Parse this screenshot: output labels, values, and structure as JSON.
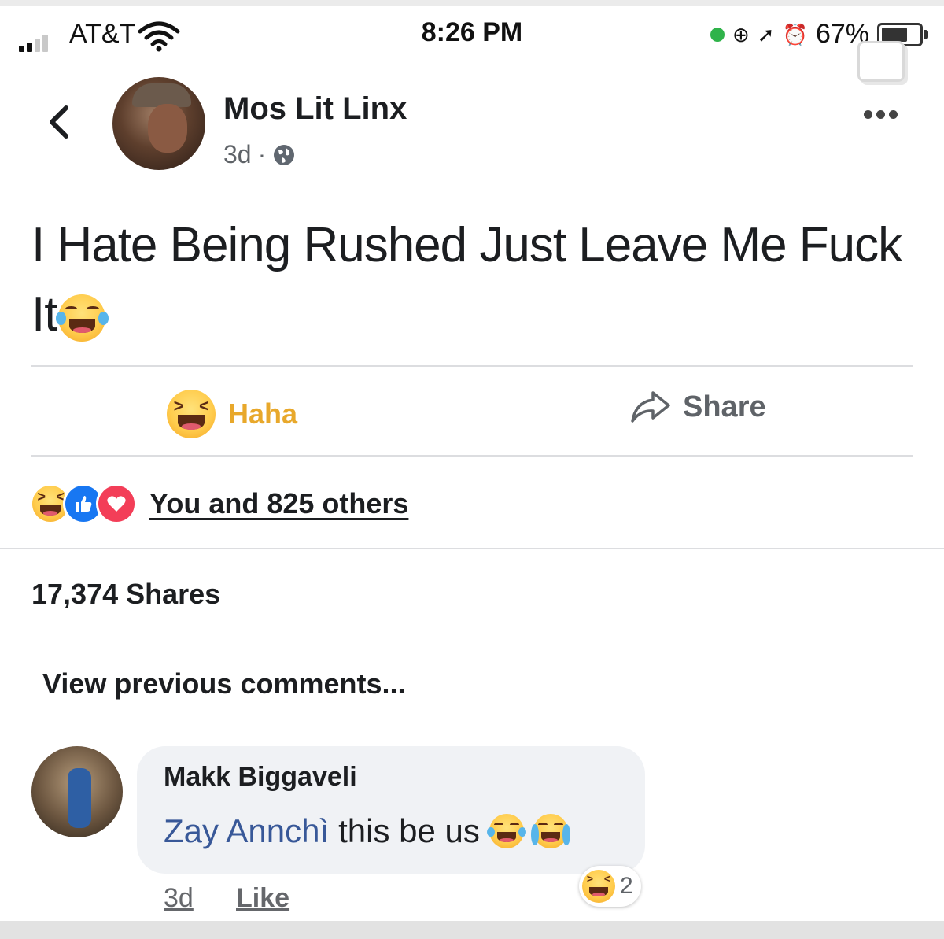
{
  "status_bar": {
    "carrier": "AT&T",
    "time": "8:26 PM",
    "battery_percent": "67%"
  },
  "post": {
    "author": "Mos Lit Linx",
    "age": "3d",
    "meta_separator": "·",
    "text": "I Hate Being Rushed Just Leave Me Fuck It"
  },
  "actions": {
    "haha_label": "Haha",
    "share_label": "Share"
  },
  "reactions": {
    "summary": "You and 825 others",
    "types": [
      "haha",
      "like",
      "love"
    ]
  },
  "shares": {
    "count_text": "17,374 Shares"
  },
  "comments": {
    "view_previous": "View previous comments...",
    "items": [
      {
        "author": "Makk Biggaveli",
        "mention": "Zay Annchì",
        "text": "this be us",
        "time": "3d",
        "like_label": "Like",
        "reaction_count": "2"
      }
    ]
  },
  "colors": {
    "haha_accent": "#e8a82b",
    "link_blue": "#385898",
    "like_blue": "#1877f2",
    "love_red": "#f33e58",
    "bubble_gray": "#f0f2f5"
  },
  "icons": [
    "signal-icon",
    "wifi-icon",
    "location-icon",
    "alarm-icon",
    "battery-icon",
    "back-chevron-icon",
    "globe-icon",
    "more-dots-icon",
    "share-arrow-icon",
    "haha-emoji-icon",
    "like-icon",
    "love-icon",
    "laughing-tears-emoji",
    "crying-emoji"
  ]
}
